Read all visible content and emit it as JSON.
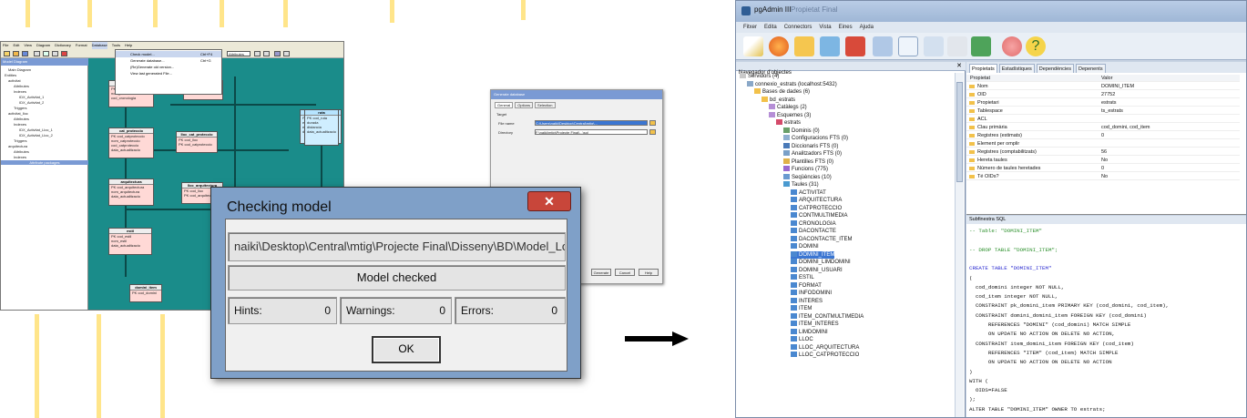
{
  "designer": {
    "menu": [
      "File",
      "Edit",
      "View",
      "Diagram",
      "Dictionary",
      "Format",
      "Database",
      "Tools",
      "Help"
    ],
    "dropdown": [
      {
        "label": "Check model...",
        "shortcut": "Ctrl+F4"
      },
      {
        "label": "Generate database...",
        "shortcut": "Ctrl+G"
      },
      {
        "label": "(Re)Generate old version...",
        "shortcut": ""
      },
      {
        "label": "View last generated File...",
        "shortcut": ""
      }
    ],
    "combo": "Attributes",
    "pane_title": "Model Diagram",
    "tree": [
      "Main Diagram",
      "Entities",
      "activitat",
      "Attributes",
      "Indexes",
      "IDX_Activitat_1",
      "IDX_Activitat_2",
      "Triggers",
      "activitat_lloc",
      "Attributes",
      "Indexes",
      "IDX_Activitat_Lloc_1",
      "IDX_Activitat_Lloc_2",
      "Triggers",
      "arquitectura",
      "Attributes",
      "Indexes"
    ],
    "footer": "Attribute packages",
    "entities": [
      {
        "name": "lloc",
        "fields": [
          "PK cod_lloc",
          "nom_lloc",
          "cod_cronologia",
          "data_actualitzacio"
        ]
      },
      {
        "name": "cat_proteccio",
        "fields": [
          "PK cod_catproteccio",
          "nom_catproteccio",
          "cod_catproteccio",
          "data_actualitzacio"
        ]
      },
      {
        "name": "lloc_cat_proteccio",
        "fields": [
          "PK cod_lloc",
          "PK cod_catproteccio"
        ]
      },
      {
        "name": "arquitectura",
        "fields": [
          "PK cod_arquitectura",
          "nom_arquitectura",
          "data_actualitzacio"
        ]
      },
      {
        "name": "lloc_arquitectura",
        "fields": [
          "PK cod_lloc",
          "PK cod_arquitectura"
        ]
      },
      {
        "name": "estil",
        "fields": [
          "PK cod_estil",
          "nom_estil",
          "cod_estil",
          "data_actualitzacio"
        ]
      },
      {
        "name": "lloc",
        "fields": [
          "PK cod_lloc",
          "ettout",
          "estat_conservacio",
          "data_actualitzacio"
        ]
      },
      {
        "name": "ruta",
        "fields": [
          "PK cod_ruta",
          "durada",
          "distancia",
          "data_actualitzacio"
        ]
      },
      {
        "name": "activitat",
        "fields": [
          "PK cod_item",
          "PK cod_activitat",
          "data_actualitzacio"
        ]
      },
      {
        "name": "domini_item",
        "fields": [
          "PK cod_domini"
        ]
      }
    ]
  },
  "options_dialog": {
    "title": "Generate database",
    "tabs": [
      "General",
      "Options",
      "Selection"
    ],
    "target_label": "Target",
    "file_label": "File name",
    "file_value": "C:\\Users\\naiki\\Desktop\\Central\\mtig\\...",
    "dir_label": "Directory",
    "dir_value": "F:\\naiki\\mtig\\Projecte Final\\...\\sql",
    "buttons": [
      "Generate",
      "Cancel",
      "Help"
    ]
  },
  "check_dialog": {
    "title": "Checking model",
    "path": "naiki\\Desktop\\Central\\mtig\\Projecte Final\\Disseny\\BD\\Model_Log",
    "status": "Model checked",
    "hints_label": "Hints:",
    "hints": "0",
    "warnings_label": "Warnings:",
    "warnings": "0",
    "errors_label": "Errors:",
    "errors": "0",
    "ok_label": "OK"
  },
  "pgadmin": {
    "title": "pgAdmin III",
    "title_extra": "Propietat Final",
    "menu": [
      "Fitxer",
      "Edita",
      "Connectors",
      "Vista",
      "Eines",
      "Ajuda"
    ],
    "nav_title": "Navegador d'objectes",
    "tree": [
      {
        "label": "Servidors (4)",
        "indent": 0
      },
      {
        "label": "connexio_estrats (localhost:5432)",
        "indent": 1
      },
      {
        "label": "Bases de dades (6)",
        "indent": 2
      },
      {
        "label": "bd_estrats",
        "indent": 3
      },
      {
        "label": "Catàlegs (2)",
        "indent": 4
      },
      {
        "label": "Esquemes (3)",
        "indent": 4
      },
      {
        "label": "estrats",
        "indent": 5
      },
      {
        "label": "Dominis (0)",
        "indent": 6
      },
      {
        "label": "Configuracions FTS (0)",
        "indent": 6
      },
      {
        "label": "Diccionaris FTS (0)",
        "indent": 6
      },
      {
        "label": "Analitzadors FTS (0)",
        "indent": 6
      },
      {
        "label": "Plantilles FTS (0)",
        "indent": 6
      },
      {
        "label": "Funcions (775)",
        "indent": 6
      },
      {
        "label": "Seqüències (10)",
        "indent": 6
      },
      {
        "label": "Taules (31)",
        "indent": 6
      },
      {
        "label": "ACTIVITAT",
        "indent": 7
      },
      {
        "label": "ARQUITECTURA",
        "indent": 7
      },
      {
        "label": "CATPROTECCIO",
        "indent": 7
      },
      {
        "label": "CONTMULTIMEDIA",
        "indent": 7
      },
      {
        "label": "CRONOLOGIA",
        "indent": 7
      },
      {
        "label": "DACONTACTE",
        "indent": 7
      },
      {
        "label": "DACONTACTE_ITEM",
        "indent": 7
      },
      {
        "label": "DOMINI",
        "indent": 7
      },
      {
        "label": "DOMINI_ITEM",
        "indent": 7,
        "selected": true
      },
      {
        "label": "DOMINI_LIMDOMINI",
        "indent": 7
      },
      {
        "label": "DOMINI_USUARI",
        "indent": 7
      },
      {
        "label": "ESTIL",
        "indent": 7
      },
      {
        "label": "FORMAT",
        "indent": 7
      },
      {
        "label": "INFODOMINI",
        "indent": 7
      },
      {
        "label": "INTERES",
        "indent": 7
      },
      {
        "label": "ITEM",
        "indent": 7
      },
      {
        "label": "ITEM_CONTMULTIMEDIA",
        "indent": 7
      },
      {
        "label": "ITEM_INTERES",
        "indent": 7
      },
      {
        "label": "LIMDOMINI",
        "indent": 7
      },
      {
        "label": "LLOC",
        "indent": 7
      },
      {
        "label": "LLOC_ARQUITECTURA",
        "indent": 7
      },
      {
        "label": "LLOC_CATPROTECCIO",
        "indent": 7
      }
    ],
    "tabs": [
      "Propietats",
      "Estadístiques",
      "Dependències",
      "Depenents"
    ],
    "prop_headers": [
      "Propietat",
      "Valor"
    ],
    "props": [
      [
        "Nom",
        "DOMINI_ITEM"
      ],
      [
        "OID",
        "27752"
      ],
      [
        "Propietari",
        "estrats"
      ],
      [
        "Tablespace",
        "ts_estrats"
      ],
      [
        "ACL",
        ""
      ],
      [
        "Clau primària",
        "cod_domini, cod_item"
      ],
      [
        "Registres (estimats)",
        "0"
      ],
      [
        "Element per omplir",
        ""
      ],
      [
        "Registres (comptabilitzats)",
        "56"
      ],
      [
        "Hereta taules",
        "No"
      ],
      [
        "Número de taules heretades",
        "0"
      ],
      [
        "Té OIDs?",
        "No"
      ]
    ],
    "sql_title": "Subfinestra SQL",
    "sql": [
      {
        "t": "-- Table: \"DOMINI_ITEM\"",
        "c": "cm"
      },
      {
        "t": "",
        "c": ""
      },
      {
        "t": "-- DROP TABLE \"DOMINI_ITEM\";",
        "c": "cm"
      },
      {
        "t": "",
        "c": ""
      },
      {
        "t": "CREATE TABLE \"DOMINI_ITEM\"",
        "c": "kw"
      },
      {
        "t": "(",
        "c": ""
      },
      {
        "t": "  cod_domini integer NOT NULL,",
        "c": ""
      },
      {
        "t": "  cod_item integer NOT NULL,",
        "c": ""
      },
      {
        "t": "  CONSTRAINT pk_domini_item PRIMARY KEY (cod_domini, cod_item),",
        "c": ""
      },
      {
        "t": "  CONSTRAINT domini_domini_item FOREIGN KEY (cod_domini)",
        "c": ""
      },
      {
        "t": "      REFERENCES \"DOMINI\" (cod_domini) MATCH SIMPLE",
        "c": ""
      },
      {
        "t": "      ON UPDATE NO ACTION ON DELETE NO ACTION,",
        "c": ""
      },
      {
        "t": "  CONSTRAINT item_domini_item FOREIGN KEY (cod_item)",
        "c": ""
      },
      {
        "t": "      REFERENCES \"ITEM\" (cod_item) MATCH SIMPLE",
        "c": ""
      },
      {
        "t": "      ON UPDATE NO ACTION ON DELETE NO ACTION",
        "c": ""
      },
      {
        "t": ")",
        "c": ""
      },
      {
        "t": "WITH (",
        "c": ""
      },
      {
        "t": "  OIDS=FALSE",
        "c": ""
      },
      {
        "t": ");",
        "c": ""
      },
      {
        "t": "ALTER TABLE \"DOMINI_ITEM\" OWNER TO estrats;",
        "c": ""
      }
    ]
  }
}
